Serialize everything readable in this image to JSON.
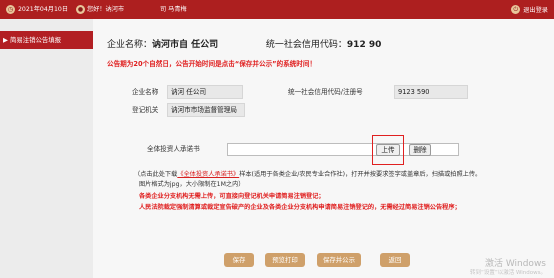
{
  "topbar": {
    "date_text": "2021年04月10日",
    "greeting": "您好！讷河市",
    "greeting_tail": "司  马青梅",
    "exit_label": "退出登录",
    "clock_icon": "clock-icon",
    "user_icon": "user-icon",
    "exit_icon": "exit-icon"
  },
  "sidebar": {
    "active_item": "简易注销公告填报"
  },
  "company": {
    "name_label": "企业名称：",
    "name_value": "讷河市自          任公司",
    "code_label": "统一社会信用代码：",
    "code_value": "912          90"
  },
  "notice": "公告期为20个自然日，公告开始时间是点击“保存并公示”的系统时间！",
  "fields": {
    "name_label": "企业名称",
    "name_value": "讷河         任公司",
    "code_label": "统一社会信用代码/注册号",
    "code_value": "9123         590",
    "authority_label": "登记机关",
    "authority_value": "讷河市市场监督管理局"
  },
  "upload": {
    "label": "全体投资人承诺书",
    "upload_button": "上传",
    "delete_button": "删除"
  },
  "notes": {
    "line1_pre": "（点击此处下载",
    "line1_link": "《全体投资人承诺书》",
    "line1_post": "样本(适用于各类企业/农民专业合作社)，打开并按要求签字或盖章后，扫描或拍照上传。",
    "line2": "图片格式为jpg，大小限制在1M之内）",
    "warn1": "各类企业分支机构无需上传，可直接向登记机关申请简易注销登记；",
    "warn2": "人民法院裁定强制清算或裁定宣告破产的企业及各类企业分支机构申请简易注销登记的，无需经过简易注销公告程序；"
  },
  "footer": {
    "save": "保存",
    "preview": "预览打印",
    "save_publish": "保存并公示",
    "back": "返回"
  },
  "watermark": {
    "line1": "激活 Windows",
    "line2": "转到“设置”以激活 Windows。"
  },
  "colors": {
    "brand_red": "#ad1f1f",
    "warning_red": "#e02020",
    "footer_button": "#cfa06a"
  }
}
